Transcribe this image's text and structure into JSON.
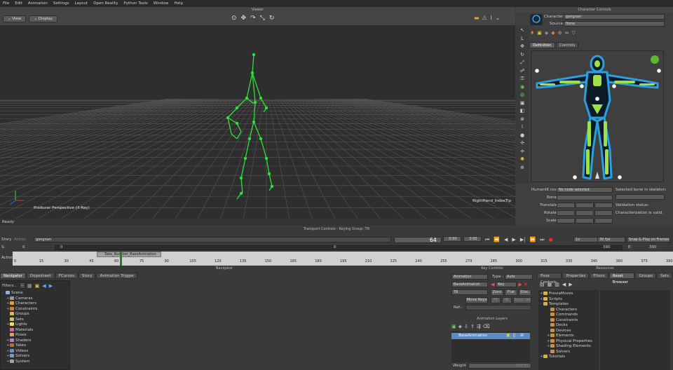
{
  "menu": [
    "File",
    "Edit",
    "Animation",
    "Settings",
    "Layout",
    "Open Reality",
    "Python Tools",
    "Window",
    "Help"
  ],
  "viewer": {
    "title": "Viewer",
    "view_btn": "View",
    "display_btn": "Display",
    "camera_label": "Producer Perspective (X-Ray)",
    "selection_label": "RightHand_IndexTip",
    "status": "Ready"
  },
  "char_controls": {
    "title": "Character Controls",
    "character_label": "Character:",
    "character_value": "gangnan",
    "source_label": "Source:",
    "source_value": "None",
    "tabs": [
      "Definition",
      "Controls"
    ],
    "humanik_label": "HumanIK node",
    "humanik_value": "No node selected.",
    "bone_label": "Bone",
    "translate_label": "Translate",
    "rotate_label": "Rotate",
    "scale_label": "Scale",
    "selected_bone_label": "Selected bone in skeleton:",
    "validation_label": "Validation status:",
    "validation_value": "Characterization is valid.",
    "status_color": "#5cb82f"
  },
  "transport": {
    "title": "Transport Controls - Keying Group: TR",
    "story_label": "Story",
    "action_label": "Action",
    "take_name": "gangnan",
    "frame_value": "64",
    "frame_unit": "0",
    "speed": "1x",
    "fps": "30 fps",
    "snap": "Snap & Play on Frames",
    "s_label": "S:",
    "s_start": "0",
    "s_mid": "0",
    "e_label": "E:",
    "e_value": "390",
    "e_top": "390",
    "mid_marker": "0",
    "action_row_label": "Action",
    "clip_label": "Take_Number_BaseAnimation",
    "ruler": [
      "0",
      "15",
      "30",
      "45",
      "60",
      "75",
      "90",
      "105",
      "120",
      "135",
      "150",
      "165",
      "180",
      "195",
      "210",
      "225",
      "240",
      "255",
      "270",
      "285",
      "300",
      "315",
      "330",
      "345",
      "360",
      "375",
      "390"
    ]
  },
  "navigator": {
    "title": "Navigator",
    "tabs": [
      "Navigator",
      "Dopesheet",
      "FCurves",
      "Story",
      "Animation Trigger"
    ],
    "filters_label": "Filters...",
    "tree": [
      {
        "label": "Scene",
        "color": "#8fb0e0",
        "expander": "-"
      },
      {
        "label": "Cameras",
        "color": "#9a9a9a",
        "expander": "+"
      },
      {
        "label": "Characters",
        "color": "#e0a040",
        "expander": "+"
      },
      {
        "label": "Constraints",
        "color": "#d08040",
        "expander": "+"
      },
      {
        "label": "Groups",
        "color": "#e0c040",
        "expander": ""
      },
      {
        "label": "Sets",
        "color": "#d0c070",
        "expander": ""
      },
      {
        "label": "Lights",
        "color": "#e8e070",
        "expander": "+"
      },
      {
        "label": "Materials",
        "color": "#d07090",
        "expander": ""
      },
      {
        "label": "Poses",
        "color": "#e0a060",
        "expander": ""
      },
      {
        "label": "Shaders",
        "color": "#b080d0",
        "expander": "+"
      },
      {
        "label": "Takes",
        "color": "#b07040",
        "expander": "+"
      },
      {
        "label": "Videos",
        "color": "#7090c0",
        "expander": "+"
      },
      {
        "label": "Solvers",
        "color": "#70a0c0",
        "expander": "+"
      },
      {
        "label": "System",
        "color": "#a0a0c0",
        "expander": "+"
      }
    ]
  },
  "key_controls": {
    "title": "Key Controls",
    "animation_label": "Animation",
    "type_label": "Type :",
    "type_value": "Auto",
    "layer_value": "BaseAnimation",
    "key_label": "Key",
    "tr_value": "TR",
    "zero_btn": "Zero",
    "flat_btn": "Flat",
    "disc_btn": "Disc.",
    "move_keys_btn": "Move Keys",
    "fk_btn": "FK",
    "ik_btn": "IK",
    "sync_btn": "Sync. all",
    "ref_label": "Ref.:",
    "layers_title": "Animation Layers",
    "layer_row": "BaseAnimation",
    "weight_label": "Weight",
    "weight_value": "100.00"
  },
  "resources": {
    "title": "Resources",
    "tabs": [
      "Pose Controls",
      "Properties",
      "Filters",
      "Asset Browser",
      "Groups",
      "Sets"
    ],
    "tree": [
      {
        "label": "PreviaMoves",
        "depth": 0,
        "expander": "+"
      },
      {
        "label": "Scripts",
        "depth": 0,
        "expander": "+"
      },
      {
        "label": "Templates",
        "depth": 0,
        "expander": "-"
      },
      {
        "label": "Characters",
        "depth": 1,
        "expander": ""
      },
      {
        "label": "Commands",
        "depth": 1,
        "expander": ""
      },
      {
        "label": "Constraints",
        "depth": 1,
        "expander": ""
      },
      {
        "label": "Decks",
        "depth": 1,
        "expander": ""
      },
      {
        "label": "Devices",
        "depth": 1,
        "expander": ""
      },
      {
        "label": "Elements",
        "depth": 1,
        "expander": "+"
      },
      {
        "label": "Physical Properties",
        "depth": 1,
        "expander": "+"
      },
      {
        "label": "Shading Elements",
        "depth": 1,
        "expander": "+"
      },
      {
        "label": "Solvers",
        "depth": 1,
        "expander": ""
      },
      {
        "label": "Tutorials",
        "depth": 0,
        "expander": "+"
      }
    ]
  }
}
